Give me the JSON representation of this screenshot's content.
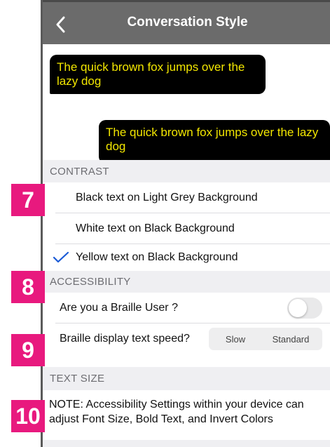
{
  "nav": {
    "title": "Conversation Style"
  },
  "preview": {
    "left_message": "The quick brown fox jumps over the lazy dog",
    "right_message": "The quick brown fox jumps over the lazy dog",
    "bubble_bg": "#000000",
    "bubble_text_color": "#f2e600"
  },
  "contrast": {
    "header": "CONTRAST",
    "options": [
      {
        "label": "Black text on Light Grey Background",
        "selected": false
      },
      {
        "label": "White text on Black Background",
        "selected": false
      },
      {
        "label": "Yellow text on Black Background",
        "selected": true
      }
    ]
  },
  "accessibility": {
    "header": "ACCESSIBILITY",
    "braille_user_label": "Are you a Braille User ?",
    "braille_user_on": false,
    "speed_label": "Braille display text speed?",
    "speed_options": [
      "Slow",
      "Standard"
    ]
  },
  "text_size": {
    "header": "TEXT SIZE",
    "note": "NOTE: Accessibility Settings within your device can adjust Font Size, Bold Text, and Invert Colors"
  },
  "badges": {
    "b7": "7",
    "b8": "8",
    "b9": "9",
    "b10": "10",
    "color": "#e8197e"
  },
  "icons": {
    "back": "chevron-left-icon",
    "selected": "checkmark-icon"
  },
  "colors": {
    "navbar": "#6b6b6b",
    "accent": "#1a5ad6",
    "section_bg": "#efeff2"
  }
}
